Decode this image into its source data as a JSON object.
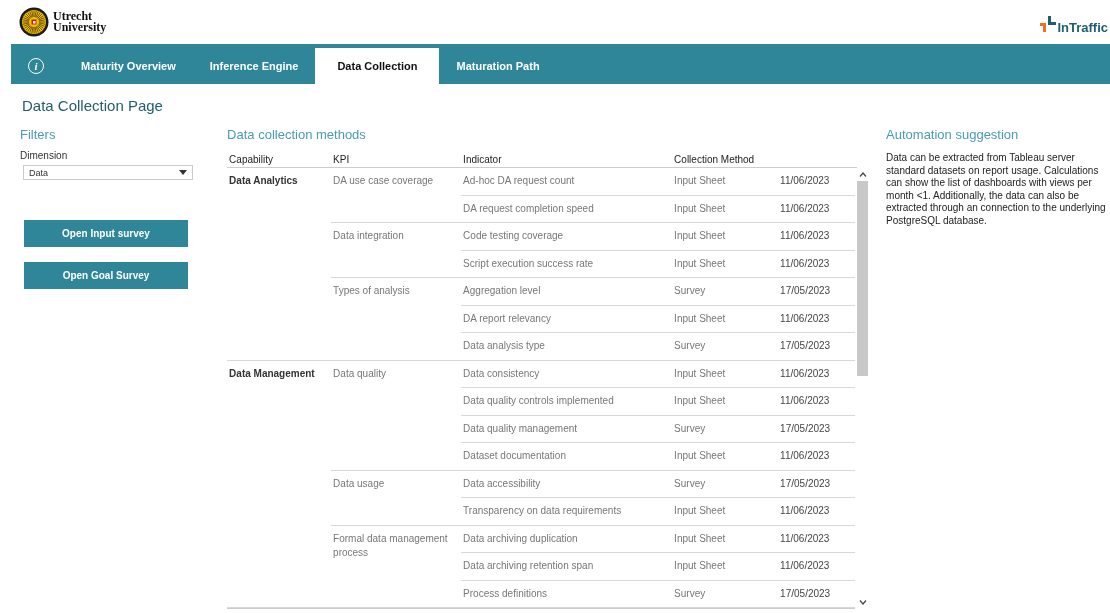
{
  "header": {
    "university": "Utrecht\nUniversity",
    "partner": "InTraffic"
  },
  "tabs": [
    {
      "kind": "info",
      "label": "i",
      "selected": false
    },
    {
      "kind": "text",
      "label": "Maturity Overview",
      "selected": false
    },
    {
      "kind": "text",
      "label": "Inference Engine",
      "selected": false
    },
    {
      "kind": "text",
      "label": "Data Collection",
      "selected": true
    },
    {
      "kind": "text",
      "label": "Maturation Path",
      "selected": false
    }
  ],
  "page_title": "Data Collection Page",
  "filters": {
    "title": "Filters",
    "dimension": {
      "label": "Dimension",
      "value": "Data"
    },
    "buttons": [
      "Open Input survey",
      "Open Goal Survey"
    ]
  },
  "table": {
    "title": "Data collection methods",
    "columns": [
      "Capability",
      "KPI",
      "Indicator",
      "Collection Method"
    ],
    "capabilities": [
      {
        "name": "Data Analytics",
        "kpis": [
          {
            "name": "DA use case coverage",
            "indicators": [
              {
                "name": "Ad-hoc DA request count",
                "method": "Input Sheet",
                "date": "11/06/2023"
              },
              {
                "name": "DA request completion speed",
                "method": "Input Sheet",
                "date": "11/06/2023"
              }
            ]
          },
          {
            "name": "Data integration",
            "indicators": [
              {
                "name": "Code testing coverage",
                "method": "Input Sheet",
                "date": "11/06/2023"
              },
              {
                "name": "Script execution success rate",
                "method": "Input Sheet",
                "date": "11/06/2023"
              }
            ]
          },
          {
            "name": "Types of analysis",
            "indicators": [
              {
                "name": "Aggregation level",
                "method": "Survey",
                "date": "17/05/2023"
              },
              {
                "name": "DA report relevancy",
                "method": "Input Sheet",
                "date": "11/06/2023"
              },
              {
                "name": "Data analysis type",
                "method": "Survey",
                "date": "17/05/2023"
              }
            ]
          }
        ]
      },
      {
        "name": "Data Management",
        "kpis": [
          {
            "name": "Data quality",
            "indicators": [
              {
                "name": "Data consistency",
                "method": "Input Sheet",
                "date": "11/06/2023"
              },
              {
                "name": "Data quality controls implemented",
                "method": "Input Sheet",
                "date": "11/06/2023"
              },
              {
                "name": "Data quality management",
                "method": "Survey",
                "date": "17/05/2023"
              },
              {
                "name": "Dataset documentation",
                "method": "Input Sheet",
                "date": "11/06/2023"
              }
            ]
          },
          {
            "name": "Data usage",
            "indicators": [
              {
                "name": "Data accessibility",
                "method": "Survey",
                "date": "17/05/2023"
              },
              {
                "name": "Transparency on data requirements",
                "method": "Input Sheet",
                "date": "11/06/2023"
              }
            ]
          },
          {
            "name": "Formal data management process",
            "indicators": [
              {
                "name": "Data archiving duplication",
                "method": "Input Sheet",
                "date": "11/06/2023"
              },
              {
                "name": "Data archiving retention span",
                "method": "Input Sheet",
                "date": "11/06/2023"
              },
              {
                "name": "Process definitions",
                "method": "Survey",
                "date": "17/05/2023"
              }
            ]
          }
        ]
      }
    ]
  },
  "automation": {
    "title": "Automation suggestion",
    "text": "Data can be extracted from Tableau server standard datasets on report usage. Calculations can show the list of dashboards with views per month <1. Additionally, the data can also be extracted through an connection to the underlying PostgreSQL database."
  }
}
